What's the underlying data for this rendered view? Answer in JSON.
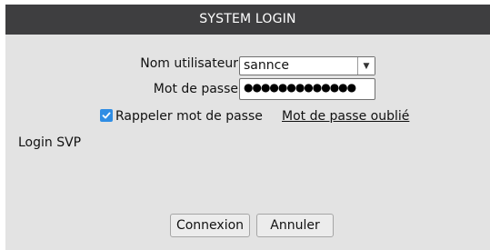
{
  "window": {
    "title": "SYSTEM LOGIN"
  },
  "form": {
    "username_label": "Nom utilisateur",
    "username_value": "sannce",
    "password_label": "Mot de passe",
    "password_mask": "●●●●●●●●●●●●●",
    "remember_label": "Rappeler mot de passe",
    "remember_checked": true,
    "forgot_link": "Mot de passe oublié"
  },
  "status": {
    "message": "Login SVP"
  },
  "buttons": {
    "login_label": "Connexion",
    "cancel_label": "Annuler"
  },
  "colors": {
    "titlebar": "#3e3e40",
    "dialog_bg": "#e3e3e3",
    "checkbox": "#2f8de4"
  }
}
